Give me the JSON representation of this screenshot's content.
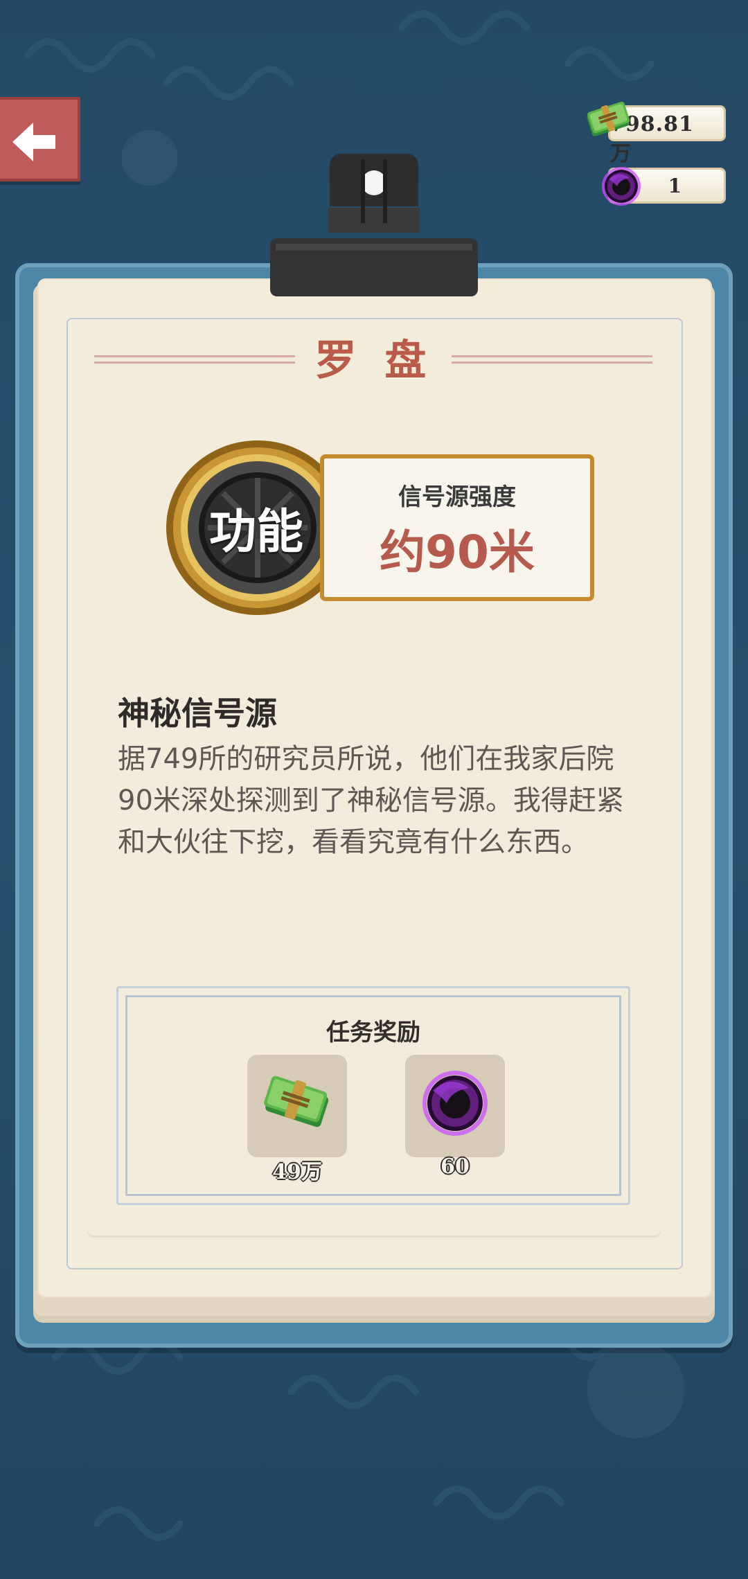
{
  "header": {
    "back_icon": "arrow-left-icon",
    "money": "798.81万",
    "orb_count": "1"
  },
  "page": {
    "title": "罗 盘",
    "badge_text": "功能",
    "signal_label": "信号源强度",
    "signal_value": "约90米"
  },
  "note": {
    "title": "神秘信号源",
    "body": "据749所的研究员所说，他们在我家后院90米深处探测到了神秘信号源。我得赶紧和大伙往下挖，看看究竟有什么东西。"
  },
  "rewards": {
    "title": "任务奖励",
    "items": [
      {
        "label": "49万",
        "icon": "money-stack-icon"
      },
      {
        "label": "60",
        "icon": "purple-orb-icon"
      }
    ]
  },
  "colors": {
    "background": "#244a68",
    "accent_red": "#b95a4b",
    "frame_blue": "#4c86a6",
    "paper": "#f4ecdb",
    "gold": "#c68b2f"
  }
}
